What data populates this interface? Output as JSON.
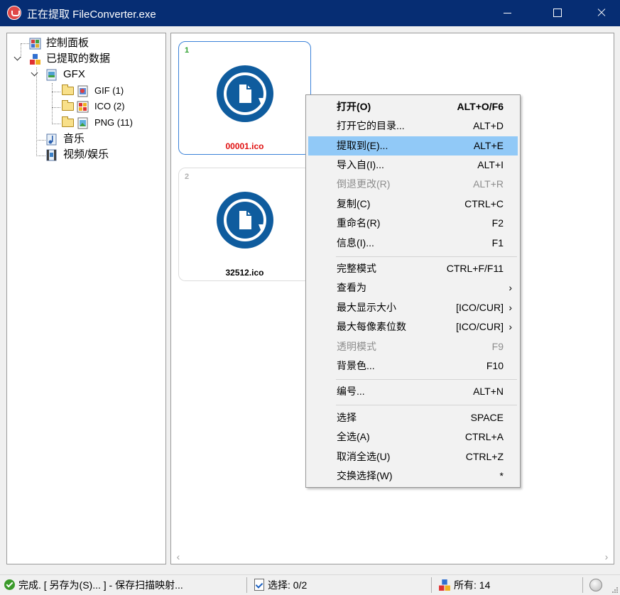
{
  "window": {
    "title": "正在提取 FileConverter.exe"
  },
  "tree": {
    "items": [
      {
        "label": "控制面板",
        "icon": "control-panel-icon"
      },
      {
        "label": "已提取的数据",
        "icon": "extracted-data-icon"
      },
      {
        "label": "GFX",
        "icon": "graphics-icon"
      },
      {
        "label": "GIF (1)",
        "icon": "folder-icon"
      },
      {
        "label": "ICO (2)",
        "icon": "folder-open-icon"
      },
      {
        "label": "PNG (11)",
        "icon": "folder-icon"
      },
      {
        "label": "音乐",
        "icon": "music-icon"
      },
      {
        "label": "视频/娱乐",
        "icon": "video-icon"
      }
    ]
  },
  "thumbnails": [
    {
      "number": "1",
      "name": "00001.ico",
      "selected": true
    },
    {
      "number": "2",
      "name": "32512.ico",
      "selected": false
    }
  ],
  "context_menu": {
    "items": [
      {
        "label": "打开(O)",
        "shortcut": "ALT+O/F6",
        "bold": true
      },
      {
        "label": "打开它的目录...",
        "shortcut": "ALT+D"
      },
      {
        "label": "提取到(E)...",
        "shortcut": "ALT+E",
        "highlighted": true
      },
      {
        "label": "导入自(I)...",
        "shortcut": "ALT+I"
      },
      {
        "label": "倒退更改(R)",
        "shortcut": "ALT+R",
        "disabled": true
      },
      {
        "label": "复制(C)",
        "shortcut": "CTRL+C"
      },
      {
        "label": "重命名(R)",
        "shortcut": "F2"
      },
      {
        "label": "信息(I)...",
        "shortcut": "F1"
      },
      {
        "label": "完整模式",
        "shortcut": "CTRL+F/F11"
      },
      {
        "label": "查看为",
        "shortcut": "",
        "arrow": "›"
      },
      {
        "label": "最大显示大小",
        "shortcut": "[ICO/CUR]",
        "arrow": "›"
      },
      {
        "label": "最大每像素位数",
        "shortcut": "[ICO/CUR]",
        "arrow": "›"
      },
      {
        "label": "透明模式",
        "shortcut": "F9",
        "disabled": true
      },
      {
        "label": "背景色...",
        "shortcut": "F10"
      },
      {
        "label": "编号...",
        "shortcut": "ALT+N"
      },
      {
        "label": "选择",
        "shortcut": "SPACE"
      },
      {
        "label": "全选(A)",
        "shortcut": "CTRL+A"
      },
      {
        "label": "取消全选(U)",
        "shortcut": "CTRL+Z"
      },
      {
        "label": "交换选择(W)",
        "shortcut": "*"
      }
    ]
  },
  "statusbar": {
    "status_text": "完成. [ 另存为(S)... ] - 保存扫描映射...",
    "selection_text": "选择: 0/2",
    "total_text": "所有: 14"
  },
  "colors": {
    "titlebar": "#062d73",
    "highlight": "#91c9f7",
    "file_icon": "#0f5c9e",
    "selected_name": "#e01010"
  }
}
